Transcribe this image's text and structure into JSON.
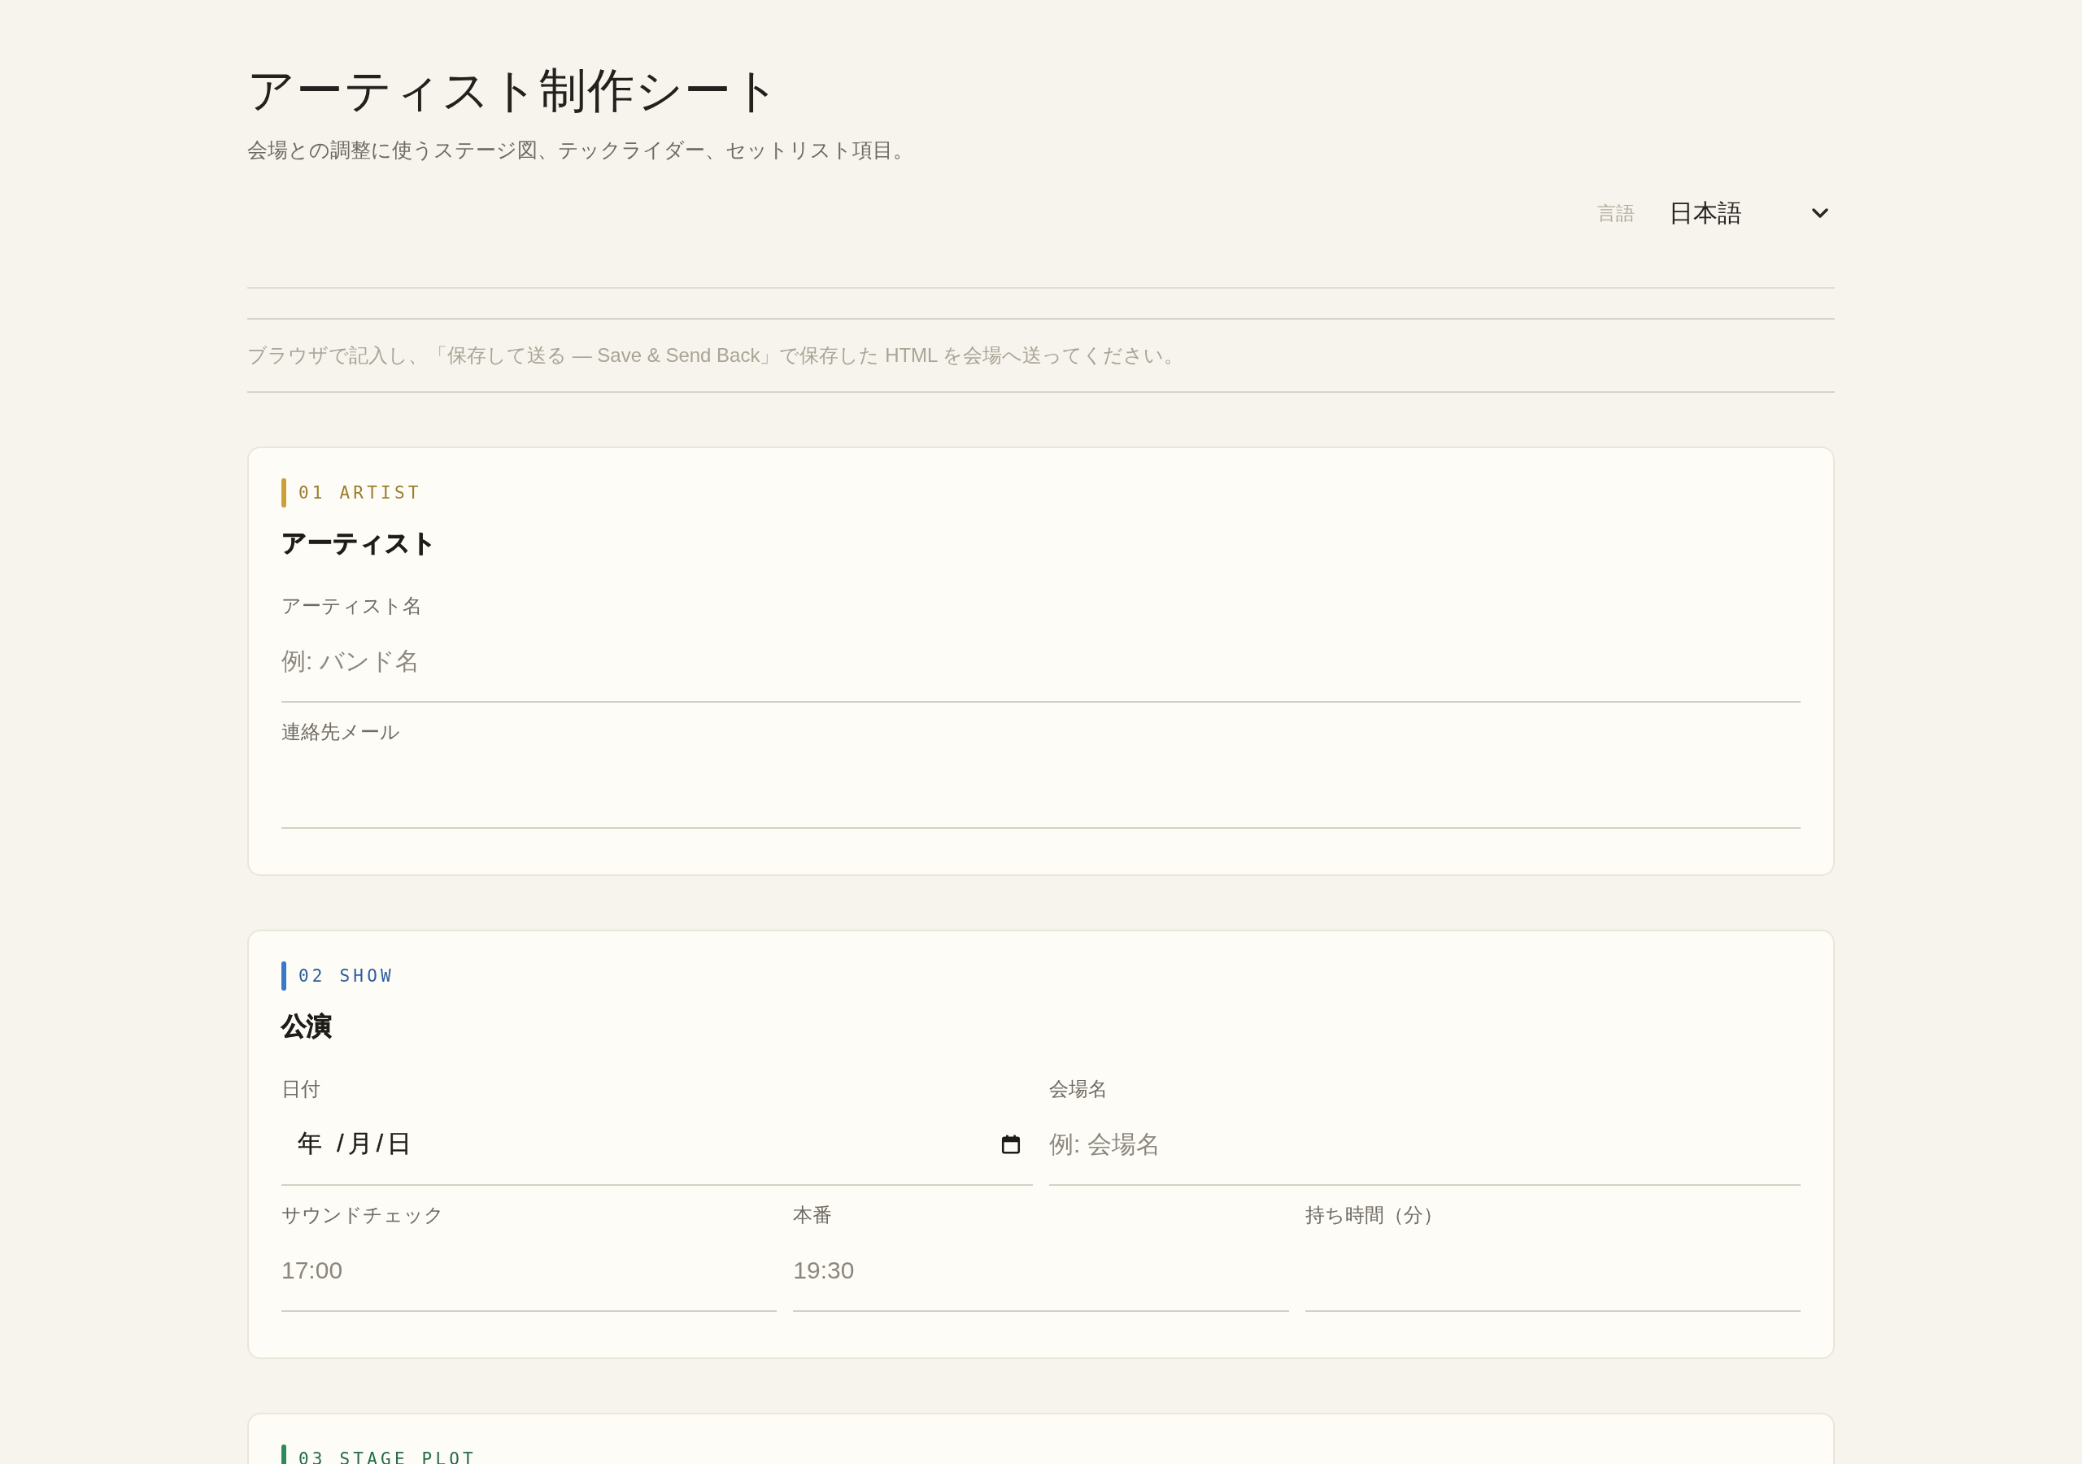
{
  "header": {
    "title": "アーティスト制作シート",
    "subtitle": "会場との調整に使うステージ図、テックライダー、セットリスト項目。",
    "language": {
      "label": "言語",
      "value": "日本語"
    }
  },
  "note": "ブラウザで記入し、「保存して送る — Save & Send Back」で保存した HTML を会場へ送ってください。",
  "sections": [
    {
      "tag": "01 ARTIST",
      "color": "#c9a13b",
      "title": "アーティスト",
      "rows": [
        [
          {
            "label": "アーティスト名",
            "kind": "text",
            "placeholder": "例: バンド名"
          }
        ],
        [
          {
            "label": "連絡先メール",
            "kind": "text"
          }
        ]
      ]
    },
    {
      "tag": "02 SHOW",
      "color": "#3a78c8",
      "title": "公演",
      "rows": [
        [
          {
            "label": "日付",
            "kind": "date",
            "placeholder": "年 /月/日"
          },
          {
            "label": "会場名",
            "kind": "text",
            "placeholder": "例: 会場名"
          }
        ],
        [
          {
            "label": "サウンドチェック",
            "kind": "text",
            "placeholder": "17:00"
          },
          {
            "label": "本番",
            "kind": "text",
            "placeholder": "19:30"
          },
          {
            "label": "持ち時間（分）",
            "kind": "text"
          }
        ]
      ]
    },
    {
      "tag": "03 STAGE PLOT",
      "color": "#2e8a5c"
    }
  ]
}
